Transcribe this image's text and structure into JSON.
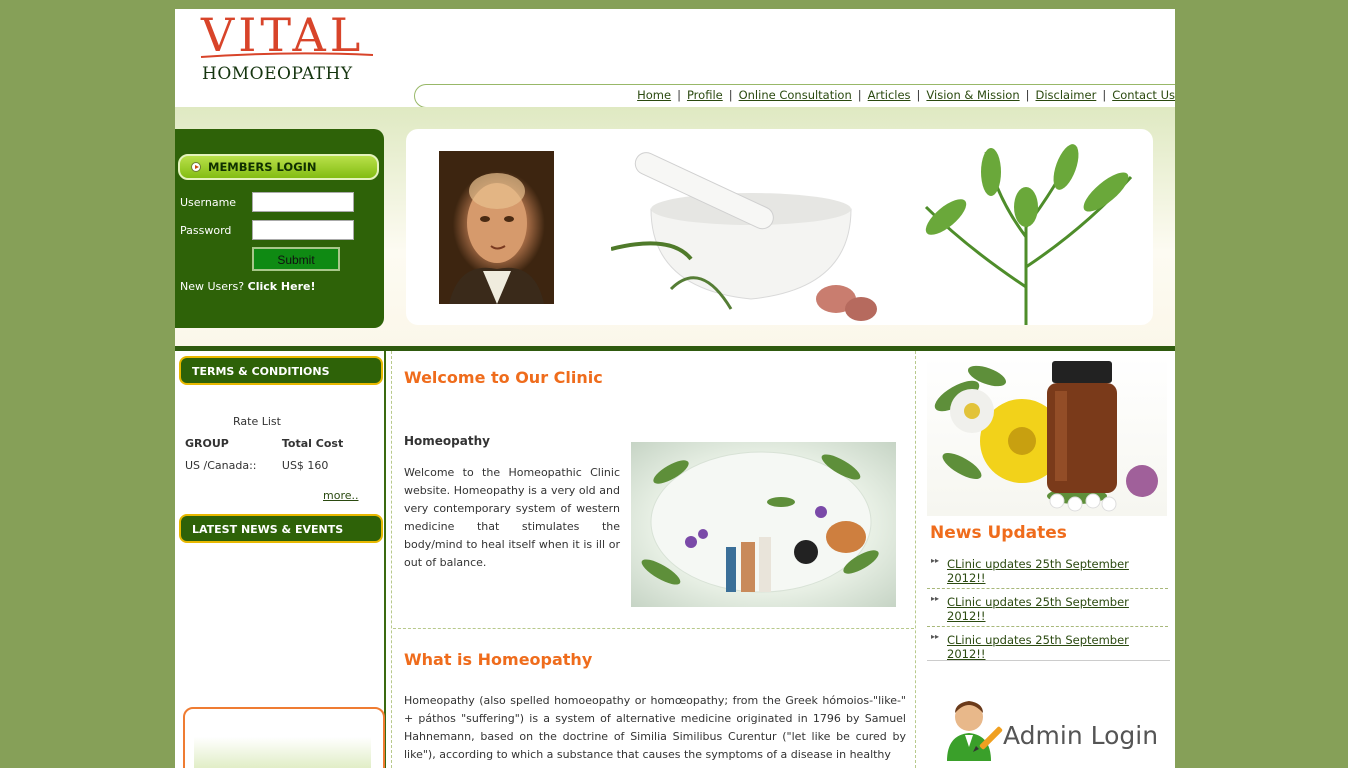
{
  "logo": {
    "word1": "VITAL",
    "word2": "HOMOEOPATHY"
  },
  "nav": {
    "items": [
      "Home",
      "Profile",
      "Online Consultation",
      "Articles",
      "Vision & Mission",
      "Disclaimer",
      "Contact Us"
    ],
    "separator": "|"
  },
  "login": {
    "heading": "MEMBERS LOGIN",
    "username_label": "Username",
    "password_label": "Password",
    "submit_label": "Submit",
    "new_users_prefix": "New Users?",
    "click_here": "Click Here!"
  },
  "terms": {
    "heading": "TERMS & CONDITIONS",
    "rate_list_title": "Rate List",
    "columns": [
      "GROUP",
      "Total Cost"
    ],
    "rows": [
      [
        "US /Canada::",
        "US$ 160"
      ]
    ],
    "more": "more.."
  },
  "latest_news": {
    "heading": "LATEST NEWS & EVENTS"
  },
  "main": {
    "welcome_heading": "Welcome to Our Clinic",
    "subheading": "Homeopathy",
    "welcome_text": "Welcome to the Homeopathic Clinic website. Homeopathy is a very old and very contemporary system of western medicine that stimulates the body/mind to heal itself when it is ill or out of balance.",
    "what_heading": "What is Homeopathy",
    "what_text": "Homeopathy (also spelled homoeopathy or homœopathy; from the Greek hómoios-\"like-\" + páthos \"suffering\") is a system of alternative medicine originated in 1796 by Samuel Hahnemann, based on the doctrine of Similia Similibus Curentur (\"let like be cured by like\"), according to which a substance that causes the symptoms of a disease in healthy"
  },
  "news_updates": {
    "heading": "News Updates",
    "items": [
      "CLinic updates 25th September 2012!!",
      "CLinic updates 25th September 2012!!",
      "CLinic updates 25th September 2012!!"
    ]
  },
  "admin": {
    "label": "Admin Login"
  },
  "colors": {
    "background": "#86a058",
    "dark_green": "#2e6208",
    "accent_orange": "#ef6c1c",
    "logo_red": "#d8442a"
  }
}
